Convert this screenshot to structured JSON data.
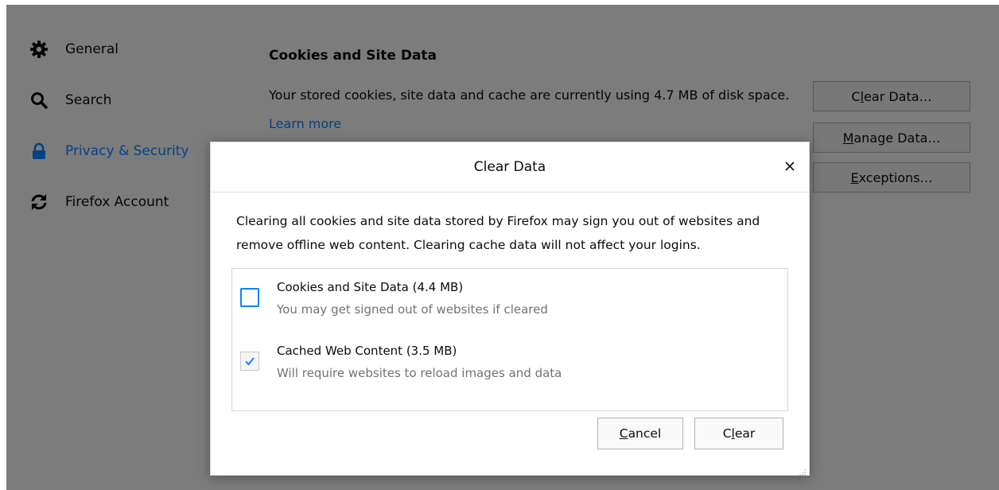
{
  "sidebar": {
    "items": [
      {
        "label": "General",
        "icon": "gear-icon"
      },
      {
        "label": "Search",
        "icon": "search-icon"
      },
      {
        "label": "Privacy & Security",
        "icon": "lock-icon",
        "selected": true
      },
      {
        "label": "Firefox Account",
        "icon": "sync-icon"
      }
    ]
  },
  "section": {
    "title": "Cookies and Site Data",
    "description": "Your stored cookies, site data and cache are currently using 4.7 MB of disk space.",
    "learn_more": "Learn more"
  },
  "buttons": {
    "clear_data": {
      "pre": "C",
      "u": "l",
      "post": "ear Data…"
    },
    "manage_data": {
      "pre": "",
      "u": "M",
      "post": "anage Data…"
    },
    "exceptions": {
      "pre": "",
      "u": "E",
      "post": "xceptions…"
    }
  },
  "dialog": {
    "title": "Clear Data",
    "close": "×",
    "description": "Clearing all cookies and site data stored by Firefox may sign you out of websites and remove offline web content. Clearing cache data will not affect your logins.",
    "options": [
      {
        "label": "Cookies and Site Data (4.4 MB)",
        "sublabel": "You may get signed out of websites if cleared",
        "checked": false
      },
      {
        "label": "Cached Web Content (3.5 MB)",
        "sublabel": "Will require websites to reload images and data",
        "checked": true
      }
    ],
    "cancel": {
      "pre": "",
      "u": "C",
      "post": "ancel"
    },
    "clear": {
      "pre": "C",
      "u": "l",
      "post": "ear"
    }
  },
  "colors": {
    "accent": "#0a84ff",
    "overlay": "rgba(0,0,0,0.5)",
    "page_bg": "#f9f9fa"
  }
}
